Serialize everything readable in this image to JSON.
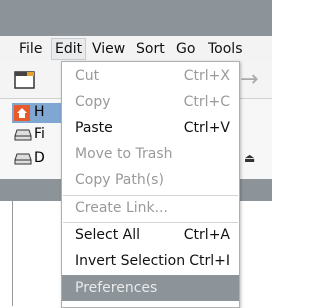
{
  "menubar": [
    "File",
    "Edit",
    "View",
    "Sort",
    "Go",
    "Tools"
  ],
  "sidebar": [
    "H",
    "Fi",
    "D"
  ],
  "edit_menu": {
    "items": [
      {
        "label": "Cut",
        "shortcut": "Ctrl+X",
        "enabled": false
      },
      {
        "label": "Copy",
        "shortcut": "Ctrl+C",
        "enabled": false
      },
      {
        "label": "Paste",
        "shortcut": "Ctrl+V",
        "enabled": true
      },
      {
        "label": "Move to Trash",
        "shortcut": "",
        "enabled": false
      },
      {
        "label": "Copy Path(s)",
        "shortcut": "",
        "enabled": false
      },
      {
        "label": "Create Link...",
        "shortcut": "",
        "enabled": false
      },
      {
        "label": "Select All",
        "shortcut": "Ctrl+A",
        "enabled": true
      },
      {
        "label": "Invert Selection",
        "shortcut": "Ctrl+I",
        "enabled": true
      },
      {
        "label": "Preferences",
        "shortcut": "",
        "enabled": true,
        "highlighted": true
      }
    ]
  },
  "colors": {
    "titlebar": "#8d9499",
    "highlight": "#8d9499",
    "selection": "#7fa7d2"
  }
}
